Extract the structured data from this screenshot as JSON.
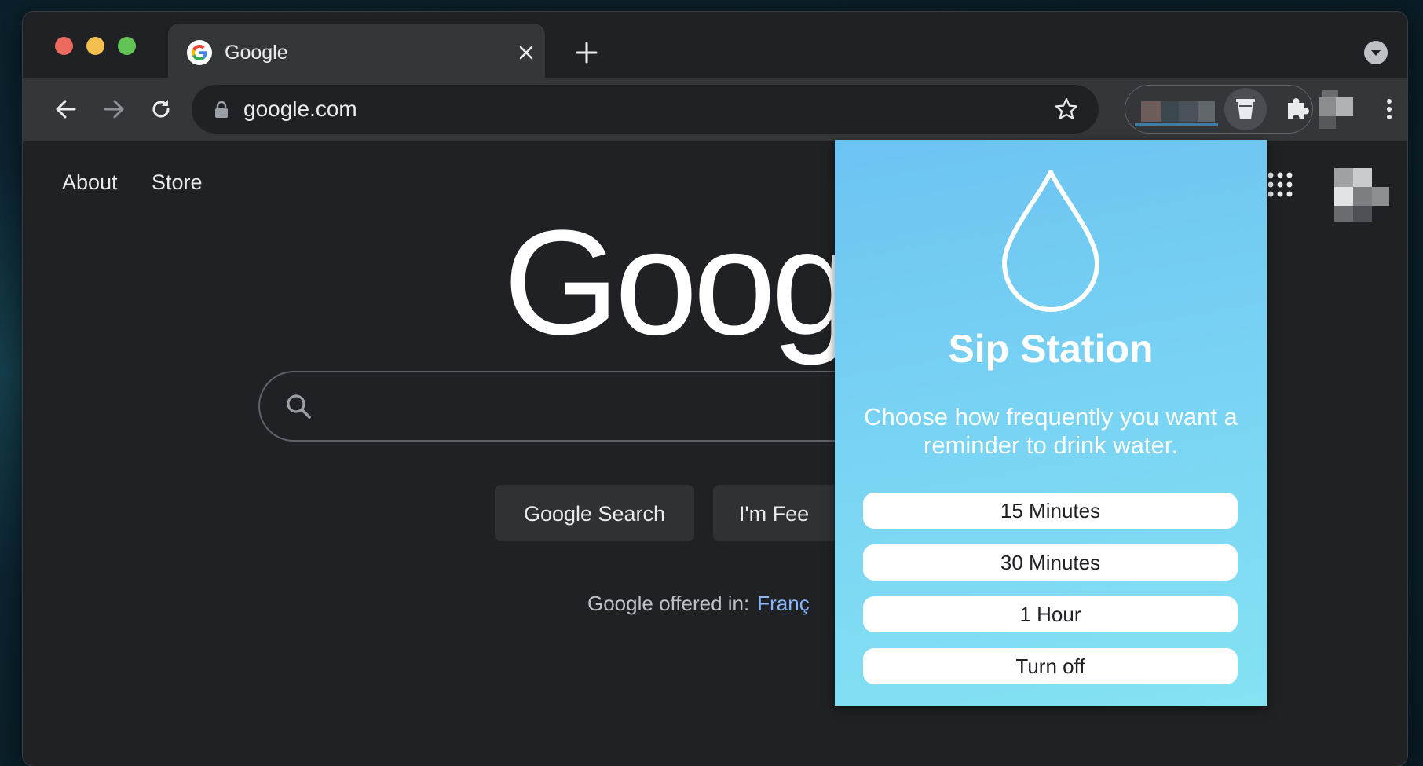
{
  "browser": {
    "tab": {
      "title": "Google",
      "favicon": "google-g-icon"
    },
    "omnibox": {
      "url": "google.com"
    },
    "icons": {
      "back": "back-arrow-icon",
      "forward": "forward-arrow-icon",
      "reload": "reload-icon",
      "lock": "lock-icon",
      "bookmark": "star-icon",
      "extension_active": "cup-icon",
      "extensions": "puzzle-icon",
      "menu": "three-dot-menu-icon",
      "tab_search": "chevron-down-icon",
      "new_tab": "plus-icon",
      "close_tab": "close-icon"
    }
  },
  "page": {
    "nav": {
      "about": "About",
      "store": "Store"
    },
    "logo": "Goog",
    "buttons": {
      "search": "Google Search",
      "lucky": "I'm Fee"
    },
    "offered": {
      "label": "Google offered in:",
      "language": "Franç"
    }
  },
  "popup": {
    "title": "Sip Station",
    "description": "Choose how frequently you want a reminder to drink water.",
    "options": [
      {
        "label": "15 Minutes"
      },
      {
        "label": "30 Minutes"
      },
      {
        "label": "1 Hour"
      },
      {
        "label": "Turn off"
      }
    ]
  },
  "colors": {
    "browser_bg": "#202124",
    "toolbar_bg": "#35363a",
    "popup_gradient_top": "#6cc3f2",
    "popup_gradient_bottom": "#84e2f3",
    "link": "#8ab4f8"
  }
}
